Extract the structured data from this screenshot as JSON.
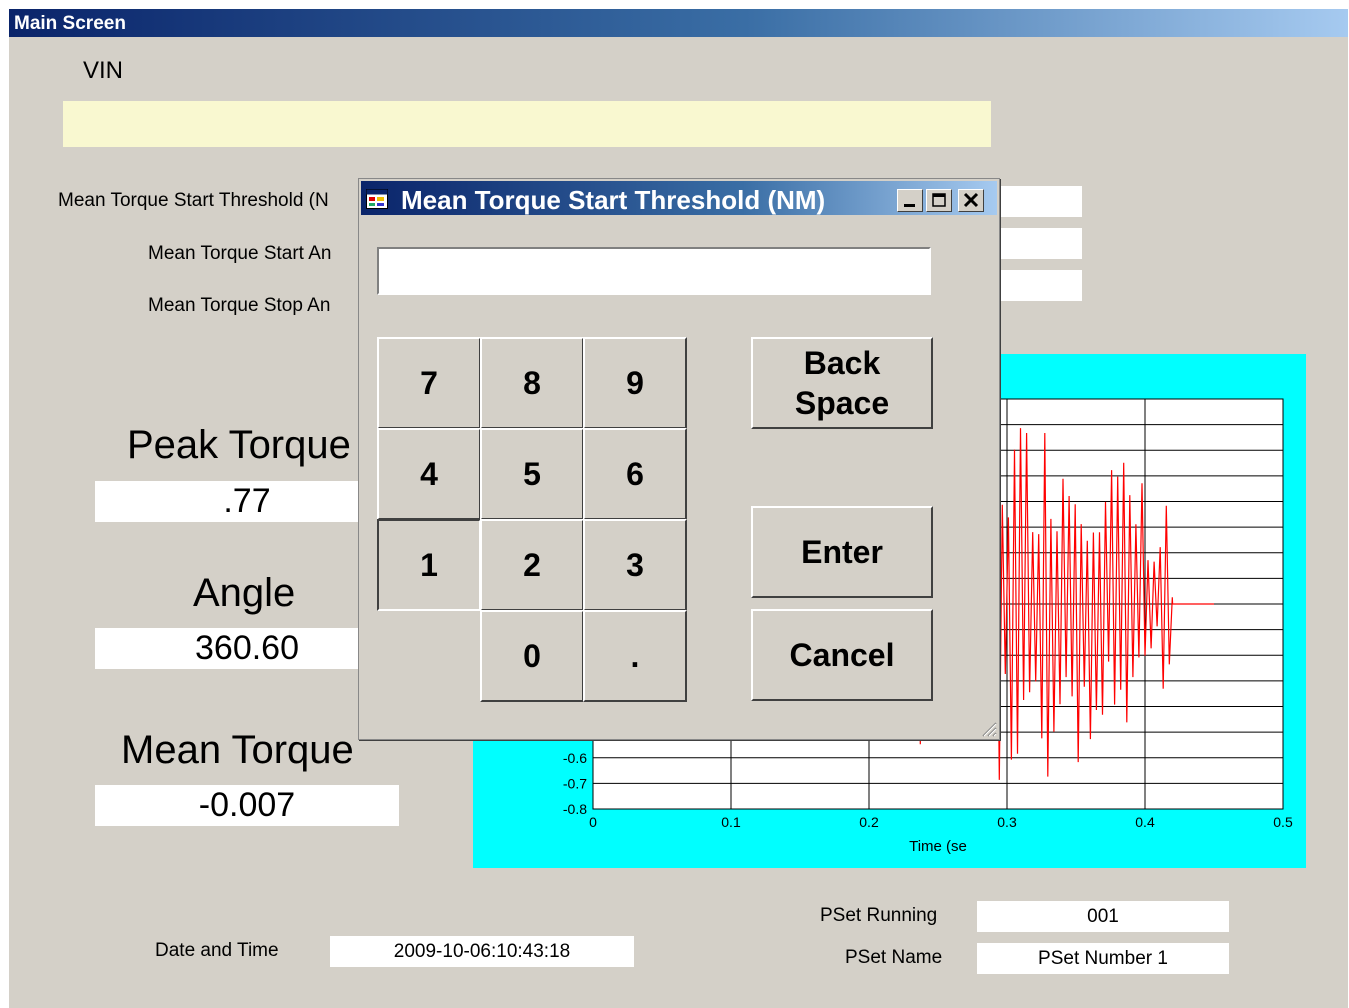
{
  "window": {
    "title": "Main Screen"
  },
  "vin": {
    "label": "VIN",
    "value": ""
  },
  "settings": {
    "start_threshold_label": "Mean Torque Start Threshold (N",
    "start_angle_label": "Mean Torque Start An",
    "stop_angle_label": "Mean Torque Stop An"
  },
  "results": {
    "peak_torque_label": "Peak Torque",
    "peak_torque_value": ".77",
    "angle_label": "Angle",
    "angle_value": "360.60",
    "mean_torque_label": "Mean Torque",
    "mean_torque_value": "-0.007"
  },
  "footer": {
    "date_label": "Date and Time",
    "date_value": "2009-10-06:10:43:18",
    "pset_running_label": "PSet Running",
    "pset_running_value": "001",
    "pset_name_label": "PSet Name",
    "pset_name_value": "PSet Number 1"
  },
  "dialog": {
    "title": "Mean Torque Start Threshold (NM)",
    "input_value": "",
    "keys": {
      "k7": "7",
      "k8": "8",
      "k9": "9",
      "k4": "4",
      "k5": "5",
      "k6": "6",
      "k1": "1",
      "k2": "2",
      "k3": "3",
      "k0": "0",
      "kdot": "."
    },
    "backspace_label": "Back Space",
    "enter_label": "Enter",
    "cancel_label": "Cancel",
    "icons": [
      "app-icon",
      "minimize-icon",
      "maximize-icon",
      "close-icon",
      "resize-grip-icon"
    ]
  },
  "chart_data": {
    "type": "line",
    "xlabel": "Time (se",
    "ylabel": "",
    "x_ticks": [
      "0",
      "0.1",
      "0.2",
      "0.3",
      "0.4",
      "0.5"
    ],
    "y_ticks_visible": [
      "-0.6",
      "-0.7",
      "-0.8"
    ],
    "xlim": [
      0,
      0.5
    ],
    "ylim": [
      -0.8,
      0.8
    ],
    "grid": true,
    "background": "#00ffff",
    "line_color": "#ff0000",
    "series": [
      {
        "x": [
          0.0,
          0.07,
          0.1,
          0.15,
          0.2,
          0.25,
          0.28,
          0.3,
          0.33,
          0.36,
          0.38,
          0.4,
          0.41,
          0.415,
          0.42,
          0.45
        ],
        "amplitude": [
          0.0,
          0.05,
          0.3,
          0.4,
          0.5,
          0.6,
          0.7,
          0.75,
          0.75,
          0.7,
          0.6,
          0.5,
          0.2,
          0.7,
          0.0,
          0.0
        ],
        "end_value": 0.0
      }
    ]
  },
  "colors": {
    "form_bg": "#d4d0c8",
    "vin_bg": "#f9f8d0",
    "title_dark": "#0a246a",
    "title_light": "#a6caf0"
  }
}
